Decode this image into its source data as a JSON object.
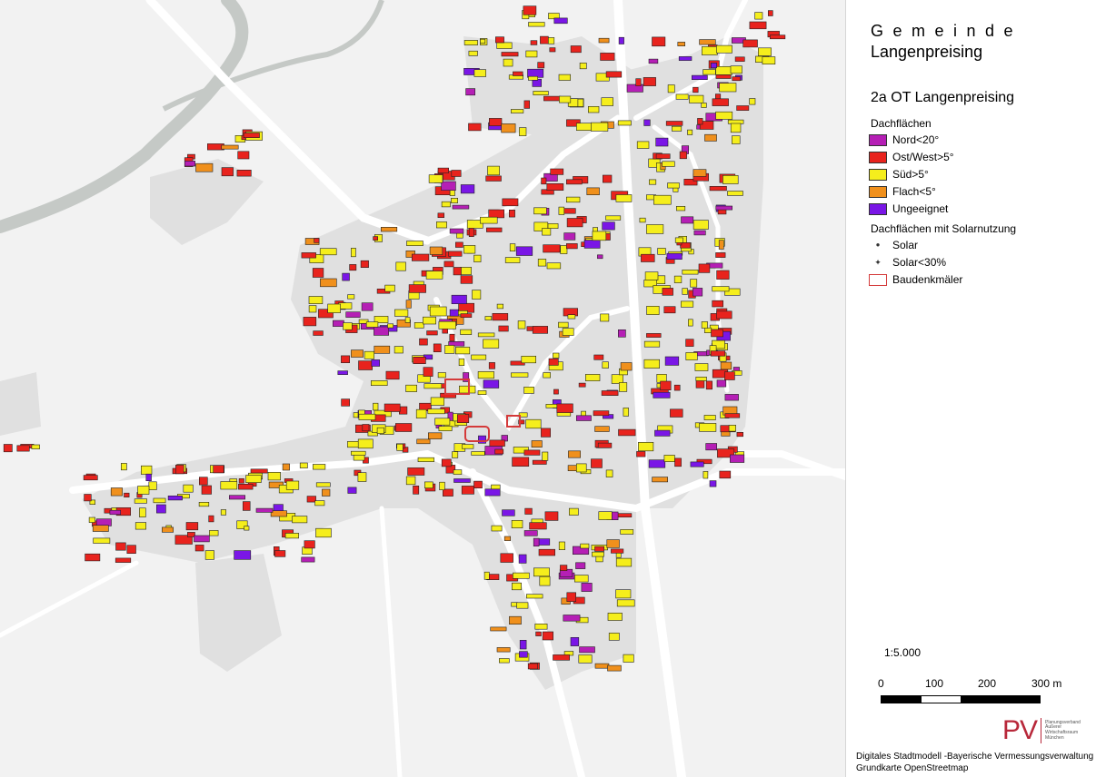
{
  "header": {
    "municipality_spaced": "Gemeinde",
    "municipality_name": "Langenpreising",
    "subtitle": "2a OT Langenpreising"
  },
  "legend": {
    "roofs_heading": "Dachflächen",
    "roof_types": [
      {
        "label": "Nord<20°",
        "color": "#b51fb5"
      },
      {
        "label": "Ost/West>5°",
        "color": "#e8231d"
      },
      {
        "label": "Süd>5°",
        "color": "#f5ee1c"
      },
      {
        "label": "Flach<5°",
        "color": "#f0901c"
      },
      {
        "label": "Ungeeignet",
        "color": "#7a16e6"
      }
    ],
    "solar_heading": "Dachflächen mit Solarnutzung",
    "solar_items": [
      {
        "label": "Solar",
        "icon": "solar-dot-icon",
        "glyph": "●"
      },
      {
        "label": "Solar<30%",
        "icon": "solar-star-icon",
        "glyph": "✦"
      }
    ],
    "monument_label": "Baudenkmäler"
  },
  "scale": {
    "ratio": "1:5.000",
    "ticks": [
      "0",
      "100",
      "200",
      "300 m"
    ]
  },
  "logo": {
    "mark": "PV",
    "text": "Planungsverband Äußerer Wirtschaftsraum München"
  },
  "credits": [
    "Digitales Stadtmodell -Bayerische Vermessungsverwaltung",
    "Grundkarte OpenStreetmap"
  ],
  "colors": {
    "map_background": "#f2f2f2",
    "settlement_area": "#e0e0e0",
    "road": "#ffffff",
    "stream": "#c5c9c6",
    "monument_outline": "#d43a3a"
  }
}
